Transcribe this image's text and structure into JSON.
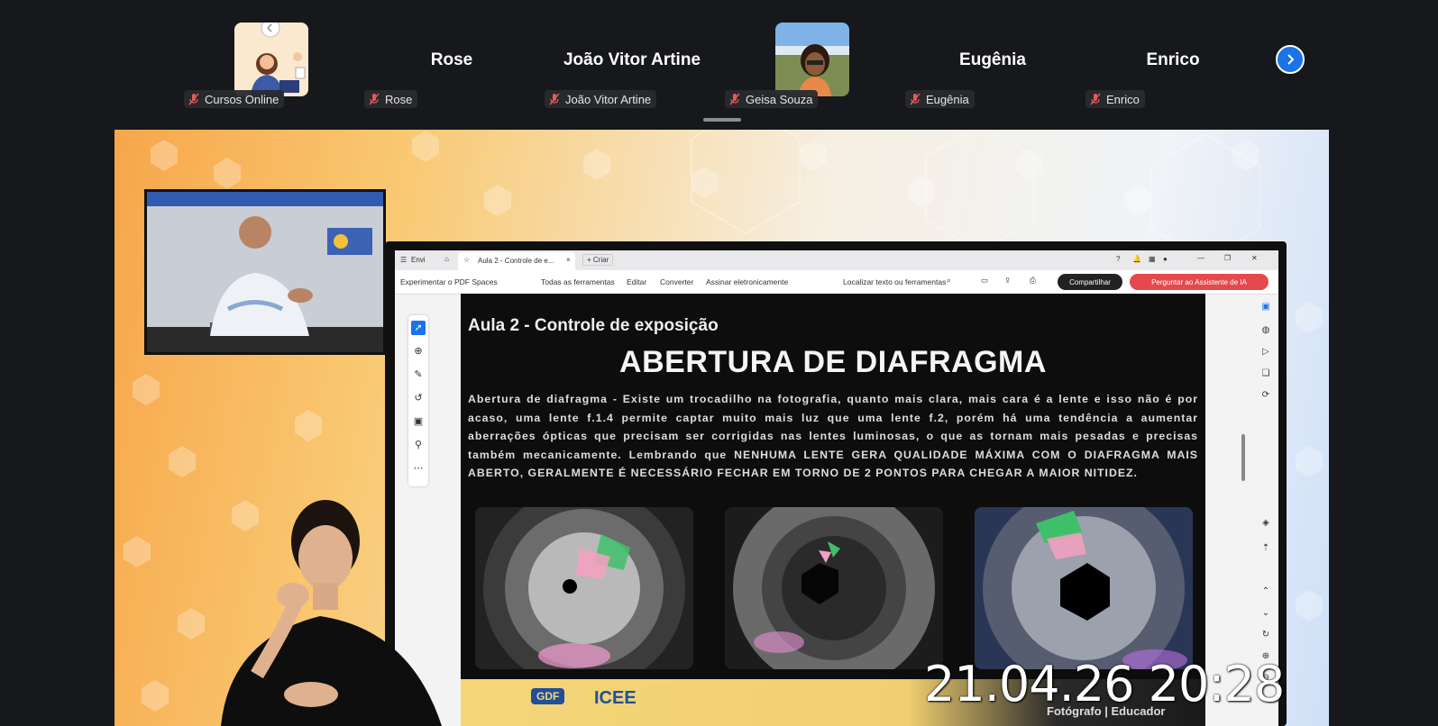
{
  "participants": [
    {
      "name": "Cursos Online",
      "display": "",
      "has_video": true,
      "muted": true
    },
    {
      "name": "Rose",
      "display": "Rose",
      "has_video": false,
      "muted": true
    },
    {
      "name": "João Vitor Artine",
      "display": "João Vitor Artine",
      "has_video": false,
      "muted": true
    },
    {
      "name": "Geisa Souza",
      "display": "",
      "has_video": true,
      "muted": true
    },
    {
      "name": "Eugênia",
      "display": "Eugênia",
      "has_video": false,
      "muted": true
    },
    {
      "name": "Enrico",
      "display": "Enrico",
      "has_video": false,
      "muted": true
    }
  ],
  "accent_color": "#1a73e8",
  "shared_screen": {
    "titlebar": {
      "tab1": "Envi",
      "tab2": "Aula 2 - Controle de e...",
      "new_tab": "Criar"
    },
    "toolbar": {
      "try_label": "Experimentar o PDF Spaces",
      "all_tools": "Todas as ferramentas",
      "edit": "Editar",
      "convert": "Converter",
      "sign": "Assinar eletronicamente",
      "search_placeholder": "Localizar texto ou ferramentas",
      "share": "Compartilhar",
      "ask": "Perguntar ao Assistente de IA"
    },
    "slide": {
      "subtitle": "Aula 2 - Controle de exposição",
      "title": "ABERTURA DE DIAFRAGMA",
      "body": "Abertura de diafragma - Existe um trocadilho na fotografia, quanto mais clara, mais cara é a lente e isso não é por acaso, uma lente f.1.4 permite captar muito mais luz que uma lente f.2, porém há uma tendência a aumentar aberrações ópticas que precisam ser corrigidas nas lentes luminosas, o que as tornam mais pesadas e precisas também mecanicamente. Lembrando que NENHUMA LENTE GERA QUALIDADE MÁXIMA COM O DIAFRAGMA MAIS ABERTO, GERALMENTE É NECESSÁRIO FECHAR EM TORNO DE 2 PONTOS PARA CHEGAR A MAIOR NITIDEZ.",
      "footer_logos": [
        "GDF",
        "ICEE"
      ],
      "footer_right": "Fotógrafo | Educador"
    }
  },
  "timestamp": "21.04.26 20:28"
}
